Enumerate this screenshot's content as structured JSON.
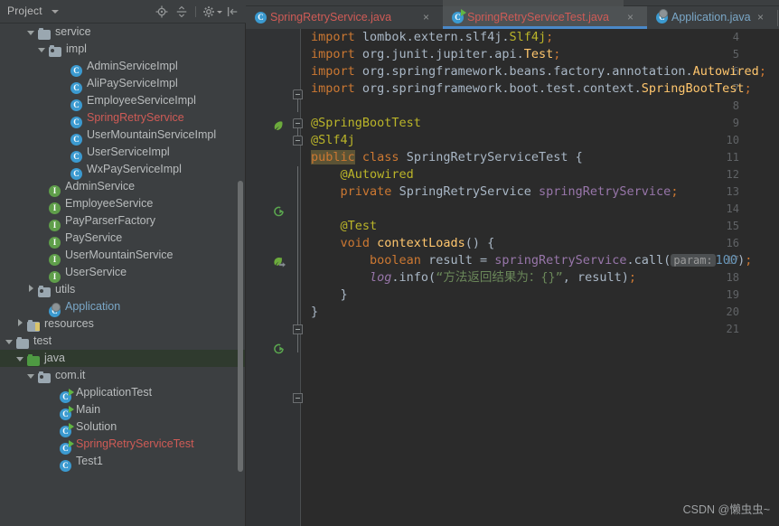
{
  "project_panel": {
    "title": "Project",
    "caret_icon": "chevron-down-icon",
    "toolbar_icons": [
      {
        "name": "locate-target-icon",
        "label": "Select Opened File"
      },
      {
        "name": "collapse-all-icon",
        "label": "Collapse All"
      },
      {
        "name": "gear-settings-icon",
        "label": "Settings"
      },
      {
        "name": "hide-panel-icon",
        "label": "Hide"
      }
    ],
    "tree": [
      {
        "indent": 3,
        "twisty": "down",
        "icon": "folder-icon",
        "label": "service",
        "color": "plain"
      },
      {
        "indent": 4,
        "twisty": "down",
        "icon": "folder-package-icon",
        "label": "impl",
        "color": "plain"
      },
      {
        "indent": 6,
        "twisty": "none",
        "icon": "class-icon",
        "label": "AdminServiceImpl",
        "color": "plain"
      },
      {
        "indent": 6,
        "twisty": "none",
        "icon": "class-icon",
        "label": "AliPayServiceImpl",
        "color": "plain"
      },
      {
        "indent": 6,
        "twisty": "none",
        "icon": "class-icon",
        "label": "EmployeeServiceImpl",
        "color": "plain"
      },
      {
        "indent": 6,
        "twisty": "none",
        "icon": "class-icon",
        "label": "SpringRetryService",
        "color": "red"
      },
      {
        "indent": 6,
        "twisty": "none",
        "icon": "class-icon",
        "label": "UserMountainServiceImpl",
        "color": "plain"
      },
      {
        "indent": 6,
        "twisty": "none",
        "icon": "class-icon",
        "label": "UserServiceImpl",
        "color": "plain"
      },
      {
        "indent": 6,
        "twisty": "none",
        "icon": "class-icon",
        "label": "WxPayServiceImpl",
        "color": "plain"
      },
      {
        "indent": 4,
        "twisty": "none",
        "icon": "interface-icon",
        "label": "AdminService",
        "color": "plain"
      },
      {
        "indent": 4,
        "twisty": "none",
        "icon": "interface-icon",
        "label": "EmployeeService",
        "color": "plain"
      },
      {
        "indent": 4,
        "twisty": "none",
        "icon": "interface-icon",
        "label": "PayParserFactory",
        "color": "plain"
      },
      {
        "indent": 4,
        "twisty": "none",
        "icon": "interface-icon",
        "label": "PayService",
        "color": "plain"
      },
      {
        "indent": 4,
        "twisty": "none",
        "icon": "interface-icon",
        "label": "UserMountainService",
        "color": "plain"
      },
      {
        "indent": 4,
        "twisty": "none",
        "icon": "interface-icon",
        "label": "UserService",
        "color": "plain"
      },
      {
        "indent": 3,
        "twisty": "right",
        "icon": "folder-package-icon",
        "label": "utils",
        "color": "plain"
      },
      {
        "indent": 4,
        "twisty": "none",
        "icon": "spring-application-icon",
        "label": "Application",
        "color": "blue"
      },
      {
        "indent": 2,
        "twisty": "right",
        "icon": "resources-folder-icon",
        "label": "resources",
        "color": "plain"
      },
      {
        "indent": 1,
        "twisty": "down",
        "icon": "folder-icon",
        "label": "test",
        "color": "plain"
      },
      {
        "indent": 2,
        "twisty": "down",
        "icon": "test-source-folder-icon",
        "label": "java",
        "color": "plain",
        "selected": true
      },
      {
        "indent": 3,
        "twisty": "down",
        "icon": "folder-package-icon",
        "label": "com.it",
        "color": "plain"
      },
      {
        "indent": 5,
        "twisty": "none",
        "icon": "runnable-class-icon",
        "label": "ApplicationTest",
        "color": "plain"
      },
      {
        "indent": 5,
        "twisty": "none",
        "icon": "runnable-class-icon",
        "label": "Main",
        "color": "plain"
      },
      {
        "indent": 5,
        "twisty": "none",
        "icon": "runnable-class-icon",
        "label": "Solution",
        "color": "plain"
      },
      {
        "indent": 5,
        "twisty": "none",
        "icon": "runnable-class-icon",
        "label": "SpringRetryServiceTest",
        "color": "red"
      },
      {
        "indent": 5,
        "twisty": "none",
        "icon": "class-icon",
        "label": "Test1",
        "color": "plain"
      }
    ]
  },
  "editor": {
    "tabs": [
      {
        "label": "SpringRetryService.java",
        "icon": "class-icon",
        "color": "red",
        "active": false,
        "close": "×"
      },
      {
        "label": "SpringRetryServiceTest.java",
        "icon": "runnable-class-icon",
        "color": "red",
        "active": true,
        "close": "×"
      },
      {
        "label": "Application.java",
        "icon": "spring-application-icon",
        "color": "blue",
        "active": false,
        "close": "×"
      }
    ],
    "first_line_number": 4,
    "last_line_number": 21,
    "gutter_markers": [
      {
        "line": 9,
        "icon": "spring-leaf-icon"
      },
      {
        "line": 11,
        "icon": "run-test-icon"
      },
      {
        "line": 13,
        "icon": "spring-bean-icon"
      },
      {
        "line": 16,
        "icon": "run-test-icon"
      }
    ],
    "lines": {
      "4": "import lombok.extern.slf4j.Slf4j;",
      "5": "import org.junit.jupiter.api.Test;",
      "6": "import org.springframework.beans.factory.annotation.Autowired;",
      "7": "import org.springframework.boot.test.context.SpringBootTest;",
      "8": "",
      "9": "@SpringBootTest",
      "10": "@Slf4j",
      "11": "public class SpringRetryServiceTest {",
      "12": "    @Autowired",
      "13": "    private SpringRetryService springRetryService;",
      "14": "",
      "15": "    @Test",
      "16": "    void contextLoads() {",
      "17": "        boolean result = springRetryService.call( param: 100);",
      "18": "        log.info(“方法返回结果为：{}”, result);",
      "19": "    }",
      "20": "}",
      "21": ""
    },
    "tokens": {
      "kw_import": "import",
      "kw_public": "public",
      "kw_class": "class",
      "kw_private": "private",
      "kw_void": "void",
      "kw_boolean": "boolean",
      "ann_springboottest": "@SpringBootTest",
      "ann_slf4j": "@Slf4j",
      "ann_autowired": "@Autowired",
      "ann_test": "@Test",
      "param_hint": "param:",
      "param_value": "100",
      "log_string": "“方法返回结果为：{}”",
      "class_name": "SpringRetryServiceTest",
      "field_name": "springRetryService",
      "method_name": "contextLoads",
      "local_var": "result"
    }
  },
  "watermark": "CSDN @懒虫虫~",
  "colors": {
    "panel_bg": "#3c3f41",
    "editor_bg": "#2b2b2b",
    "gutter_bg": "#313335",
    "accent_tab_underline": "#4a88c7",
    "selected_row": "#2f3a2e",
    "text_default": "#bbbbbb",
    "code_default": "#a9b7c6",
    "keyword": "#cc7832",
    "annotation": "#bbb529",
    "class_ref": "#ffc66d",
    "field": "#9876aa",
    "string": "#6a8759",
    "number": "#6897bb",
    "modified_file": "#cf5b56",
    "line_number": "#606366"
  }
}
